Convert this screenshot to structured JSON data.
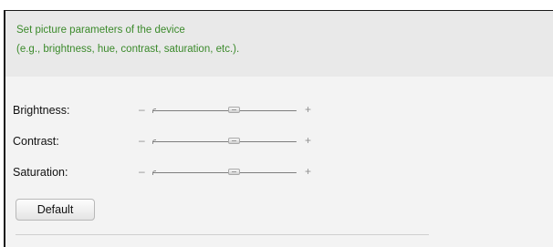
{
  "info": {
    "line1": "Set picture parameters of the device",
    "line2": "(e.g., brightness, hue, contrast, saturation, etc.)."
  },
  "sliders": [
    {
      "label": "Brightness:",
      "minus": "–",
      "plus": "+",
      "value": 0.5
    },
    {
      "label": "Contrast:",
      "minus": "–",
      "plus": "+",
      "value": 0.5
    },
    {
      "label": "Saturation:",
      "minus": "–",
      "plus": "+",
      "value": 0.5
    }
  ],
  "default_button": "Default"
}
